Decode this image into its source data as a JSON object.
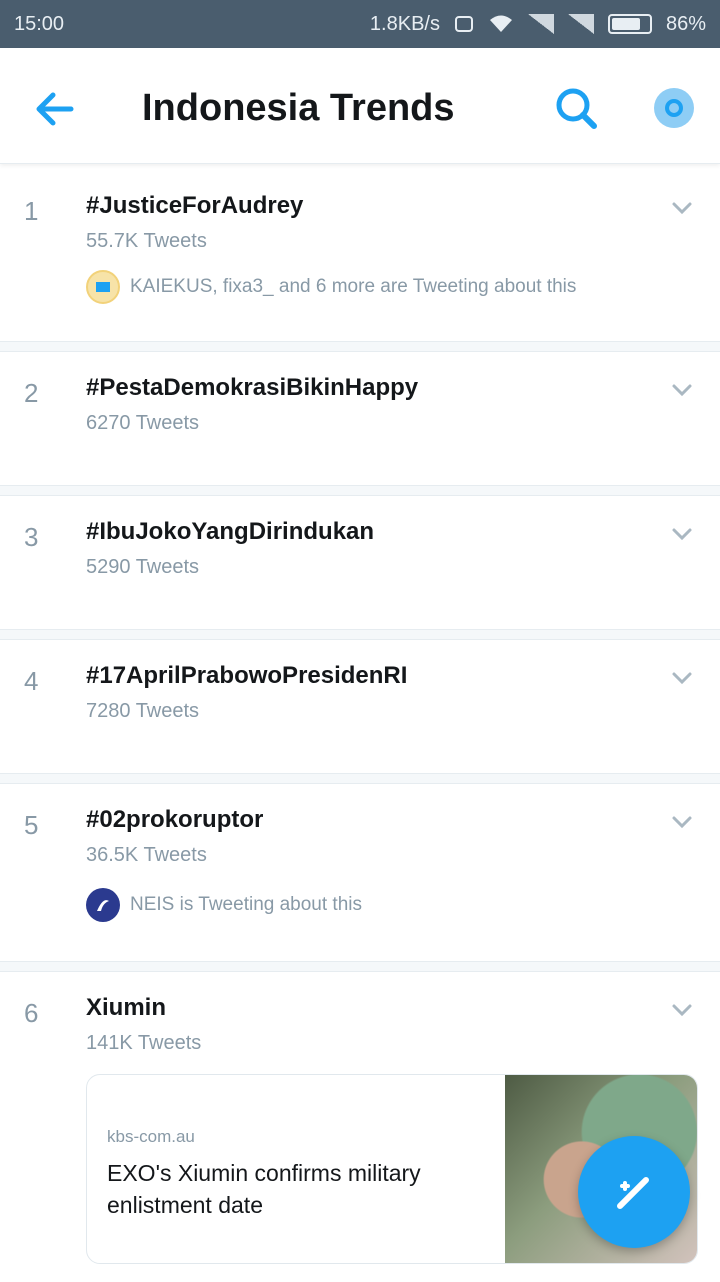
{
  "status_bar": {
    "time": "15:00",
    "network_speed": "1.8KB/s",
    "battery": "86%"
  },
  "header": {
    "title": "Indonesia Trends",
    "back_icon": "arrow-left-icon",
    "search_icon": "search-icon",
    "settings_icon": "settings-icon"
  },
  "trends": [
    {
      "rank": "1",
      "name": "#JusticeForAudrey",
      "count": "55.7K Tweets",
      "context": "KAIEKUS, fixa3_ and 6 more are Tweeting about this"
    },
    {
      "rank": "2",
      "name": "#PestaDemokrasiBikinHappy",
      "count": "6270 Tweets"
    },
    {
      "rank": "3",
      "name": "#IbuJokoYangDirindukan",
      "count": "5290 Tweets"
    },
    {
      "rank": "4",
      "name": "#17AprilPrabowoPresidenRI",
      "count": "7280 Tweets"
    },
    {
      "rank": "5",
      "name": "#02prokoruptor",
      "count": "36.5K Tweets",
      "context": "NEIS is Tweeting about this"
    },
    {
      "rank": "6",
      "name": "Xiumin",
      "count": "141K Tweets",
      "news": {
        "source": "kbs-com.au",
        "headline": "EXO's Xiumin confirms military enlistment date"
      }
    }
  ],
  "fab": {
    "icon": "compose-tweet-icon"
  },
  "colors": {
    "accent": "#1da1f2",
    "status_bar_bg": "#4a5d6e",
    "text_primary": "#14171a",
    "text_secondary": "#8899a6"
  }
}
